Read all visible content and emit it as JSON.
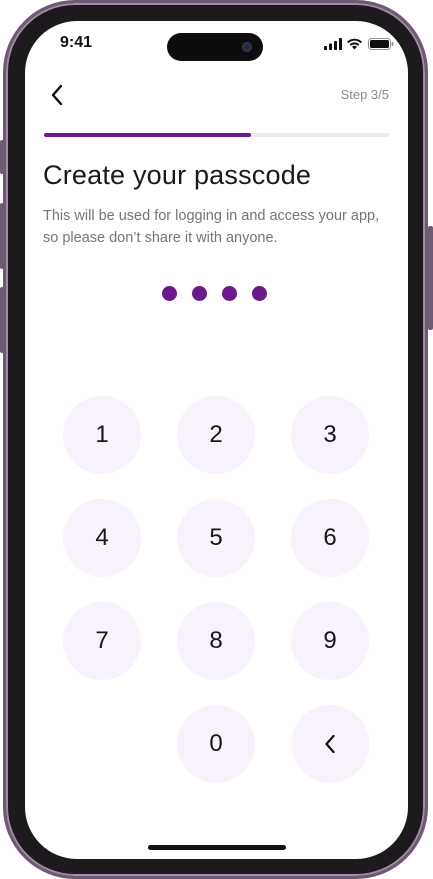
{
  "status_bar": {
    "time": "9:41",
    "icons": [
      "cellular-signal-icon",
      "wifi-icon",
      "battery-icon"
    ]
  },
  "header": {
    "back_icon": "chevron-left-icon",
    "step_label": "Step 3/5",
    "progress_fraction": 0.6
  },
  "content": {
    "title": "Create your passcode",
    "subtitle": "This will be used for logging in and access your app, so please don’t share it with anyone.",
    "entered_digits": 4
  },
  "keypad": {
    "keys": [
      "1",
      "2",
      "3",
      "4",
      "5",
      "6",
      "7",
      "8",
      "9",
      "0"
    ],
    "delete_icon": "chevron-left-icon"
  },
  "colors": {
    "accent": "#6a1b8a",
    "key_background": "#f7f2fb",
    "track": "#ececec"
  }
}
